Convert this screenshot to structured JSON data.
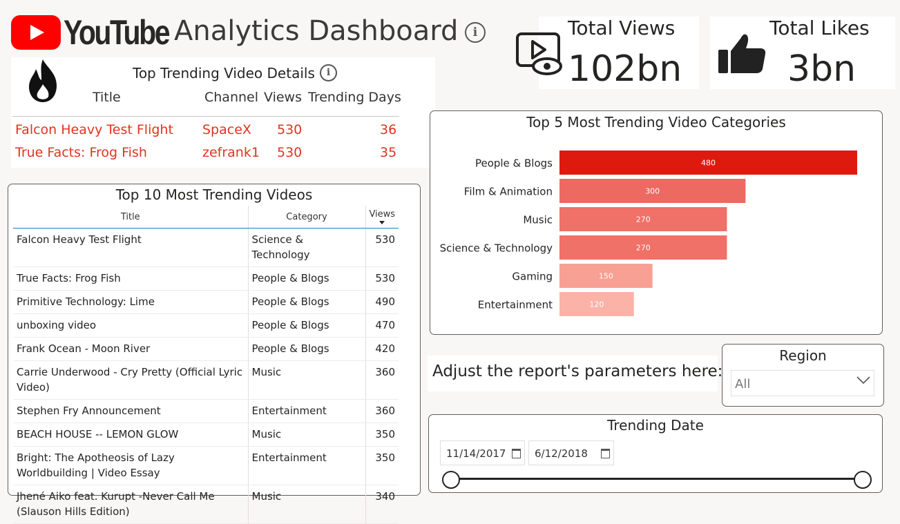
{
  "header": {
    "logo_text": "YouTube",
    "title": "Analytics Dashboard",
    "info_glyph": "i"
  },
  "kpis": {
    "views": {
      "label": "Total Views",
      "value": "102bn",
      "icon": "eye-screen-icon"
    },
    "likes": {
      "label": "Total Likes",
      "value": "3bn",
      "icon": "thumbs-up-icon"
    }
  },
  "trending_details": {
    "title": "Top Trending Video Details",
    "icon": "fire-icon",
    "columns": [
      "Title",
      "Channel",
      "Views",
      "Trending Days"
    ],
    "rows": [
      [
        "Falcon Heavy Test Flight",
        "SpaceX",
        "530",
        "36"
      ],
      [
        "True Facts: Frog Fish",
        "zefrank1",
        "530",
        "35"
      ]
    ],
    "accent": "#e0331f"
  },
  "top10": {
    "title": "Top 10 Most Trending Videos",
    "columns": [
      "Title",
      "Category",
      "Views"
    ],
    "rows": [
      [
        "Falcon Heavy Test Flight",
        "Science & Technology",
        "530"
      ],
      [
        "True Facts: Frog Fish",
        "People & Blogs",
        "530"
      ],
      [
        "Primitive Technology: Lime",
        "People & Blogs",
        "490"
      ],
      [
        "unboxing video",
        "People & Blogs",
        "470"
      ],
      [
        "Frank Ocean - Moon River",
        "People & Blogs",
        "420"
      ],
      [
        "Carrie Underwood - Cry Pretty (Official Lyric Video)",
        "Music",
        "360"
      ],
      [
        "Stephen Fry Announcement",
        "Entertainment",
        "360"
      ],
      [
        "BEACH HOUSE -- LEMON GLOW",
        "Music",
        "350"
      ],
      [
        "Bright: The Apotheosis of Lazy Worldbuilding | Video Essay",
        "Entertainment",
        "350"
      ],
      [
        "Jhené Aiko feat. Kurupt -Never Call Me (Slauson Hills Edition)",
        "Music",
        "340"
      ]
    ]
  },
  "chart_data": {
    "type": "bar",
    "title": "Top 5 Most Trending Video Categories",
    "categories": [
      "People & Blogs",
      "Film & Animation",
      "Music",
      "Science & Technology",
      "Gaming",
      "Entertainment"
    ],
    "values": [
      480,
      300,
      270,
      270,
      150,
      120
    ],
    "colors": [
      "#de1a0f",
      "#ec6a61",
      "#ef7167",
      "#ef7167",
      "#f8a093",
      "#fbb3a7"
    ],
    "xlim": [
      0,
      480
    ],
    "grid": false,
    "orientation": "horizontal"
  },
  "params": {
    "prompt": "Adjust the report's parameters here:",
    "region": {
      "title": "Region",
      "value": "All"
    },
    "trending_date": {
      "title": "Trending Date",
      "start": "11/14/2017",
      "end": "6/12/2018"
    }
  }
}
